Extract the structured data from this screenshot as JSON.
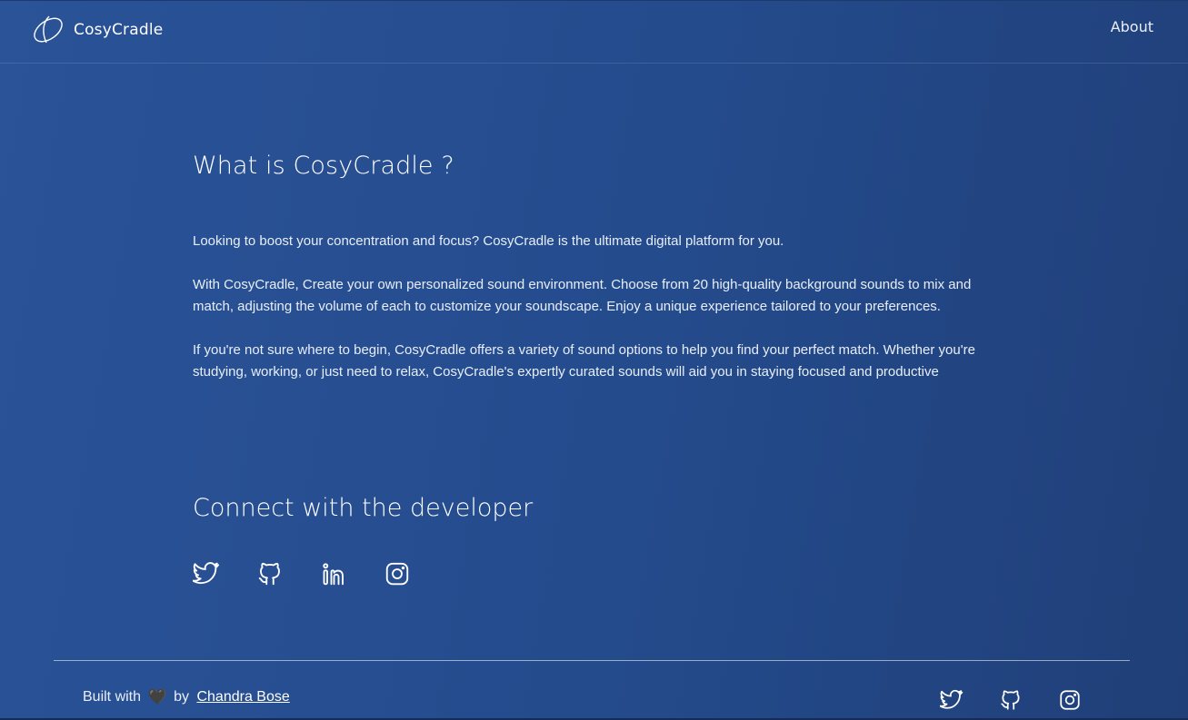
{
  "header": {
    "brand_name": "CosyCradle",
    "nav": [
      {
        "label": "About"
      }
    ]
  },
  "main": {
    "title": "What is CosyCradle ?",
    "paragraphs": [
      "Looking to boost your concentration and focus? CosyCradle is the ultimate digital platform for you.",
      "With CosyCradle, Create your own personalized sound environment. Choose from 20 high-quality background sounds to mix and match, adjusting the volume of each to customize your soundscape. Enjoy a unique experience tailored to your preferences.",
      "If you're not sure where to begin, CosyCradle offers a variety of sound options to help you find your perfect match. Whether you're studying, working, or just need to relax, CosyCradle's expertly curated sounds will aid you in staying focused and productive"
    ],
    "connect_title": "Connect with the developer",
    "social_icons": [
      "twitter-icon",
      "github-icon",
      "linkedin-icon",
      "instagram-icon"
    ]
  },
  "footer": {
    "built_with": "Built with",
    "heart": "🖤",
    "by": "by",
    "author": "Chandra Bose",
    "social_icons": [
      "twitter-icon",
      "github-icon",
      "instagram-icon"
    ]
  },
  "colors": {
    "background_left": "#2a5398",
    "background_right": "#203f78",
    "text": "#ffffff"
  }
}
